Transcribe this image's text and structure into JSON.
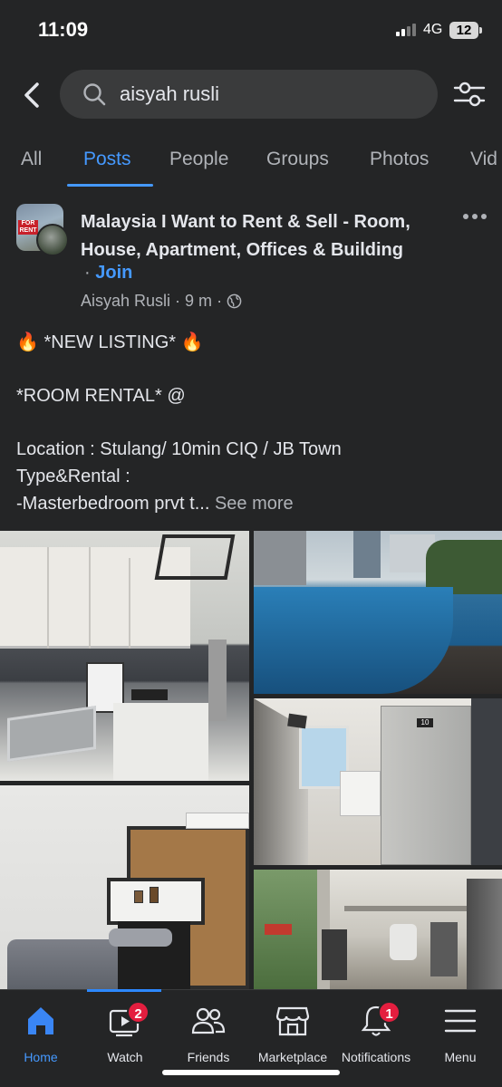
{
  "status": {
    "time": "11:09",
    "network": "4G",
    "battery": "12"
  },
  "search": {
    "query": "aisyah rusli",
    "placeholder": "Search"
  },
  "tabs": [
    {
      "label": "All"
    },
    {
      "label": "Posts"
    },
    {
      "label": "People"
    },
    {
      "label": "Groups"
    },
    {
      "label": "Photos"
    },
    {
      "label": "Vid"
    }
  ],
  "post": {
    "group_name": "Malaysia I Want to Rent & Sell - Room, House, Apartment, Offices & Building",
    "join_dot": "·",
    "join_label": "Join",
    "author": "Aisyah Rusli",
    "time": "9 m",
    "separator": "·",
    "avatar_sign": "FOR RENT",
    "lines": {
      "l1": "*NEW LISTING*",
      "l2": "*ROOM RENTAL* @",
      "l3": "Location : Stulang/ 10min CIQ / JB Town",
      "l4": "Type&Rental :",
      "l5": "-Masterbedroom prvt t..."
    },
    "fire_emoji": "🔥",
    "see_more": "See more",
    "fridge_tag": "10"
  },
  "nav": [
    {
      "label": "Home",
      "icon": "home-icon",
      "active": true
    },
    {
      "label": "Watch",
      "icon": "watch-icon",
      "badge": "2"
    },
    {
      "label": "Friends",
      "icon": "friends-icon"
    },
    {
      "label": "Marketplace",
      "icon": "marketplace-icon"
    },
    {
      "label": "Notifications",
      "icon": "bell-icon",
      "badge": "1"
    },
    {
      "label": "Menu",
      "icon": "menu-icon"
    }
  ],
  "colors": {
    "background": "#242526",
    "accent": "#4599ff",
    "badge": "#e41e3f",
    "muted": "#b0b3b8"
  }
}
